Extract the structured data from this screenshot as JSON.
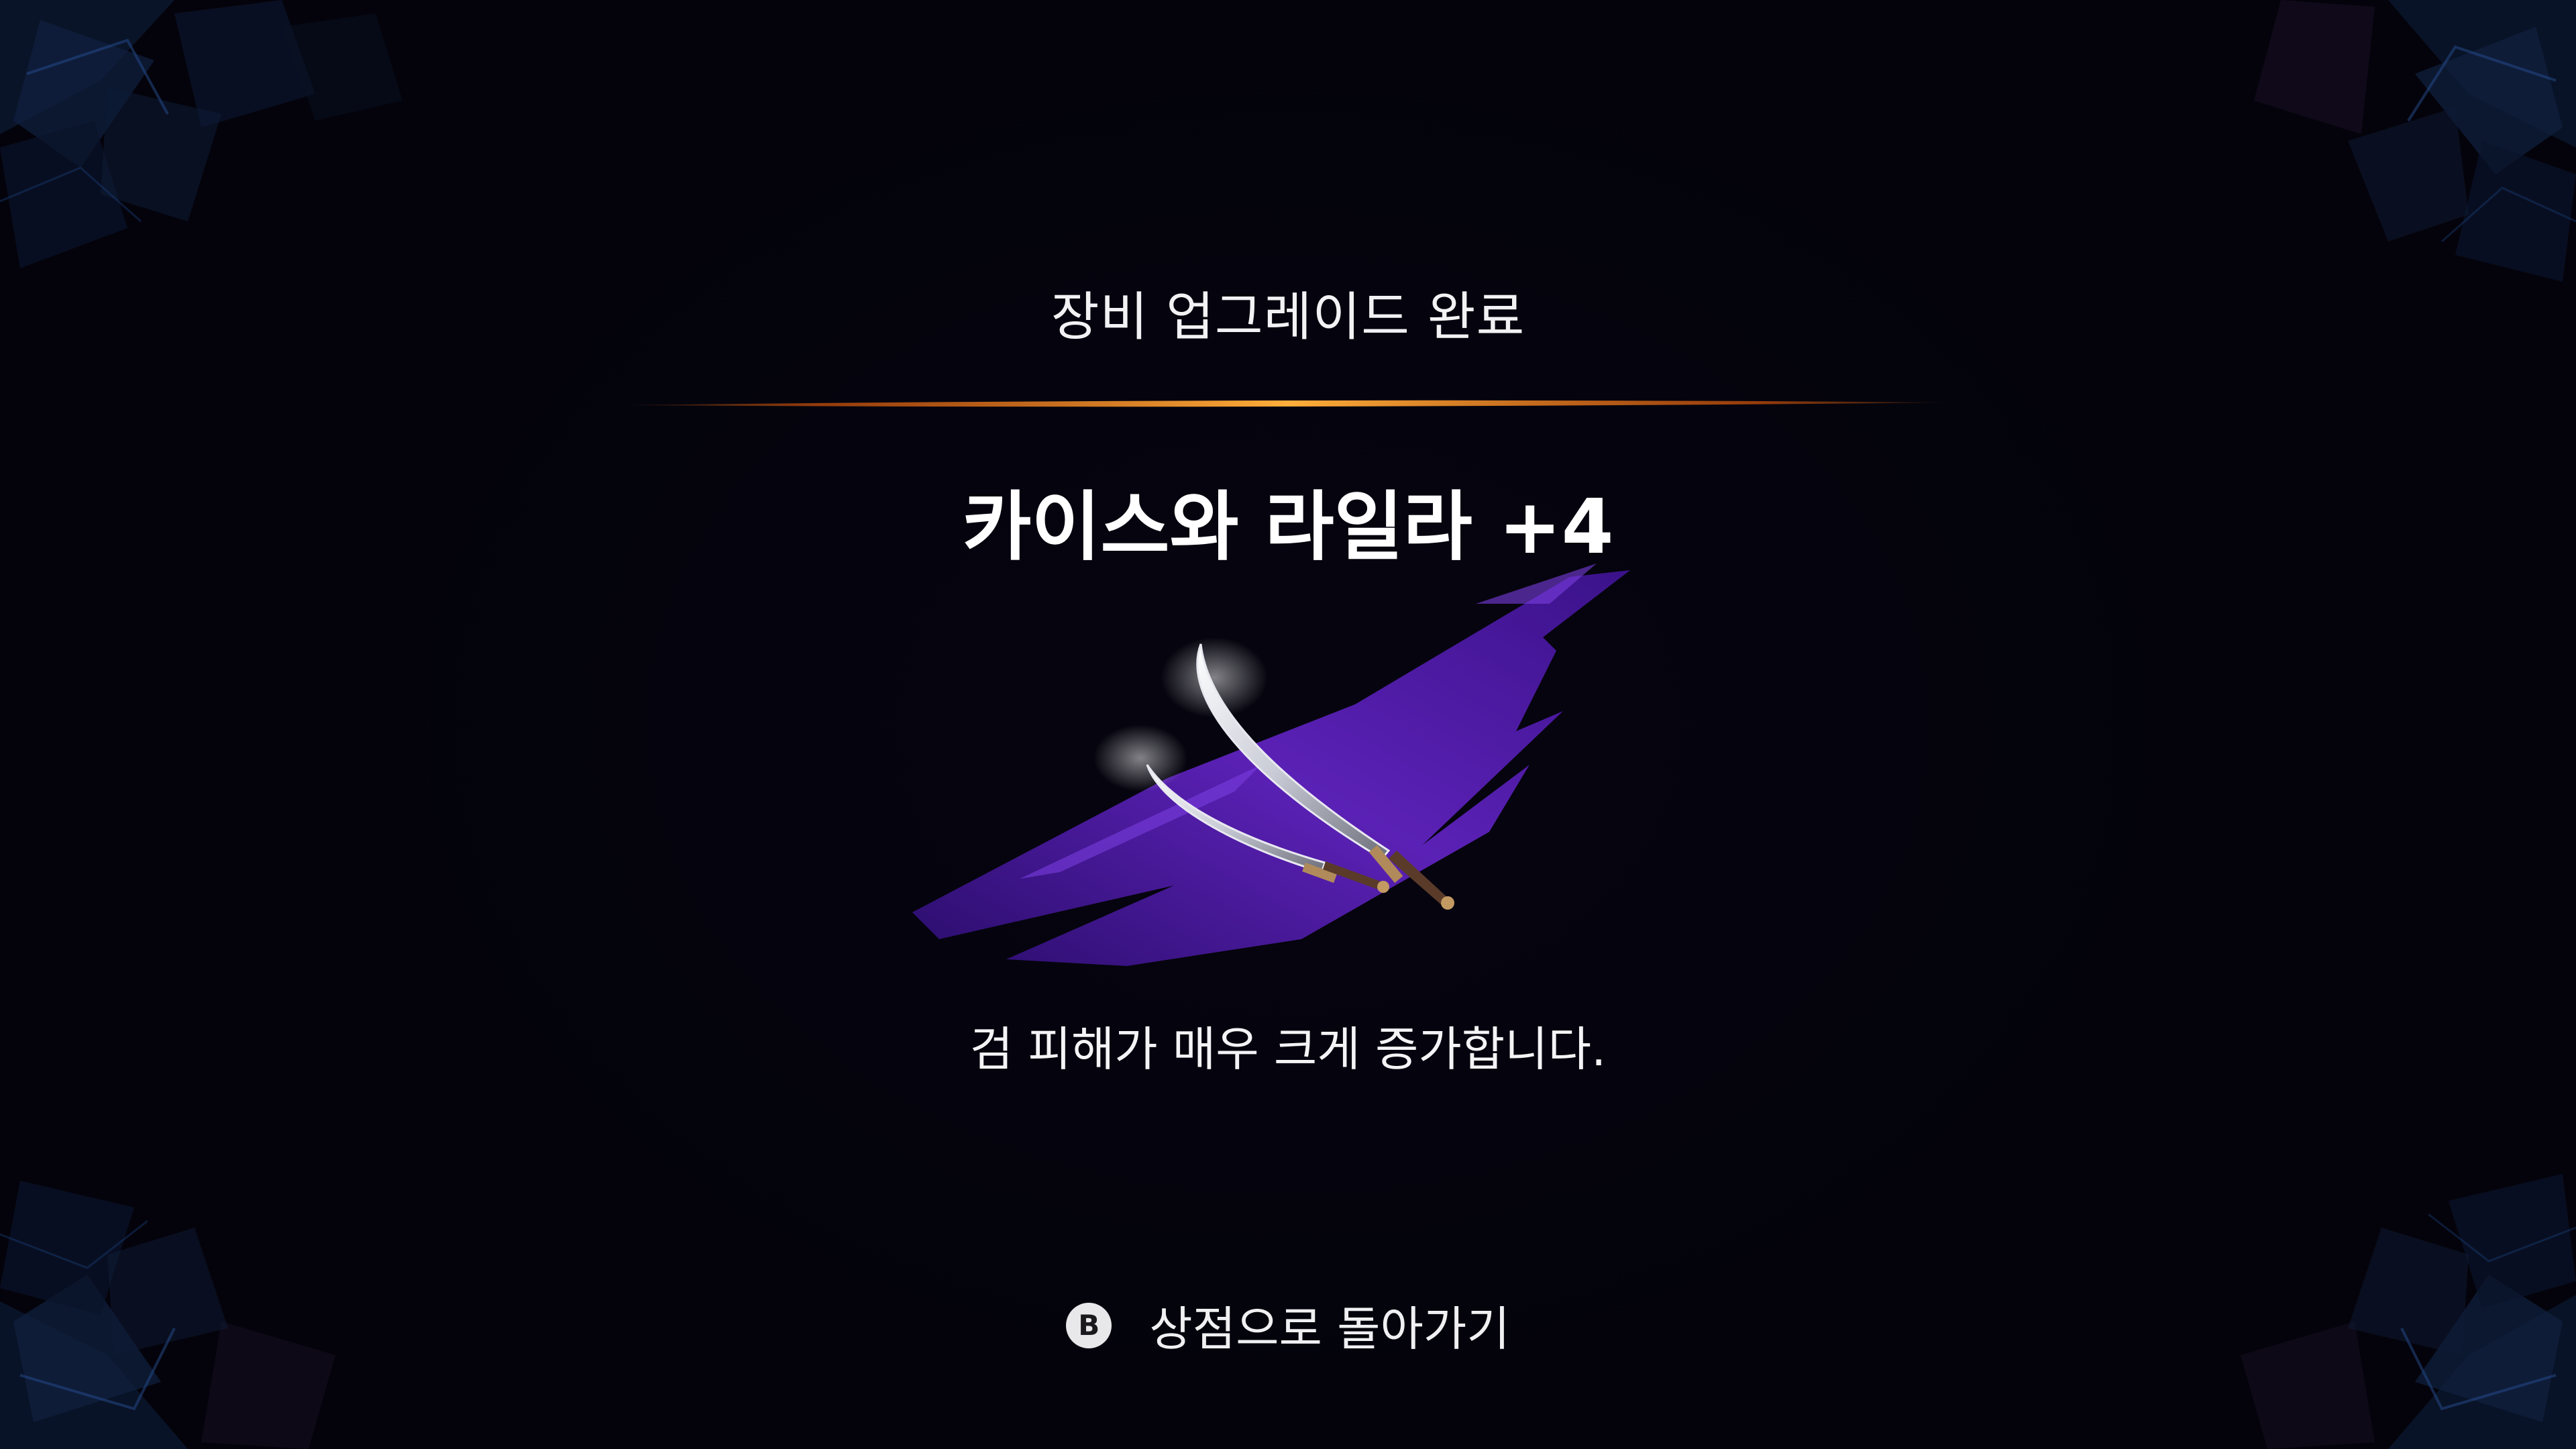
{
  "screen": {
    "header_title": "장비 업그레이드 완료",
    "item_name": "카이스와 라일라 +4",
    "item_icon": "twin-curved-swords-icon",
    "item_description": "검 피해가 매우 크게 증가합니다.",
    "back_prompt": {
      "button_glyph": "B",
      "label": "상점으로 돌아가기"
    }
  },
  "colors": {
    "background": "#05040d",
    "divider_accent": "#ff8a1e",
    "item_backdrop": "#5a1fb0",
    "text": "#ffffff"
  }
}
